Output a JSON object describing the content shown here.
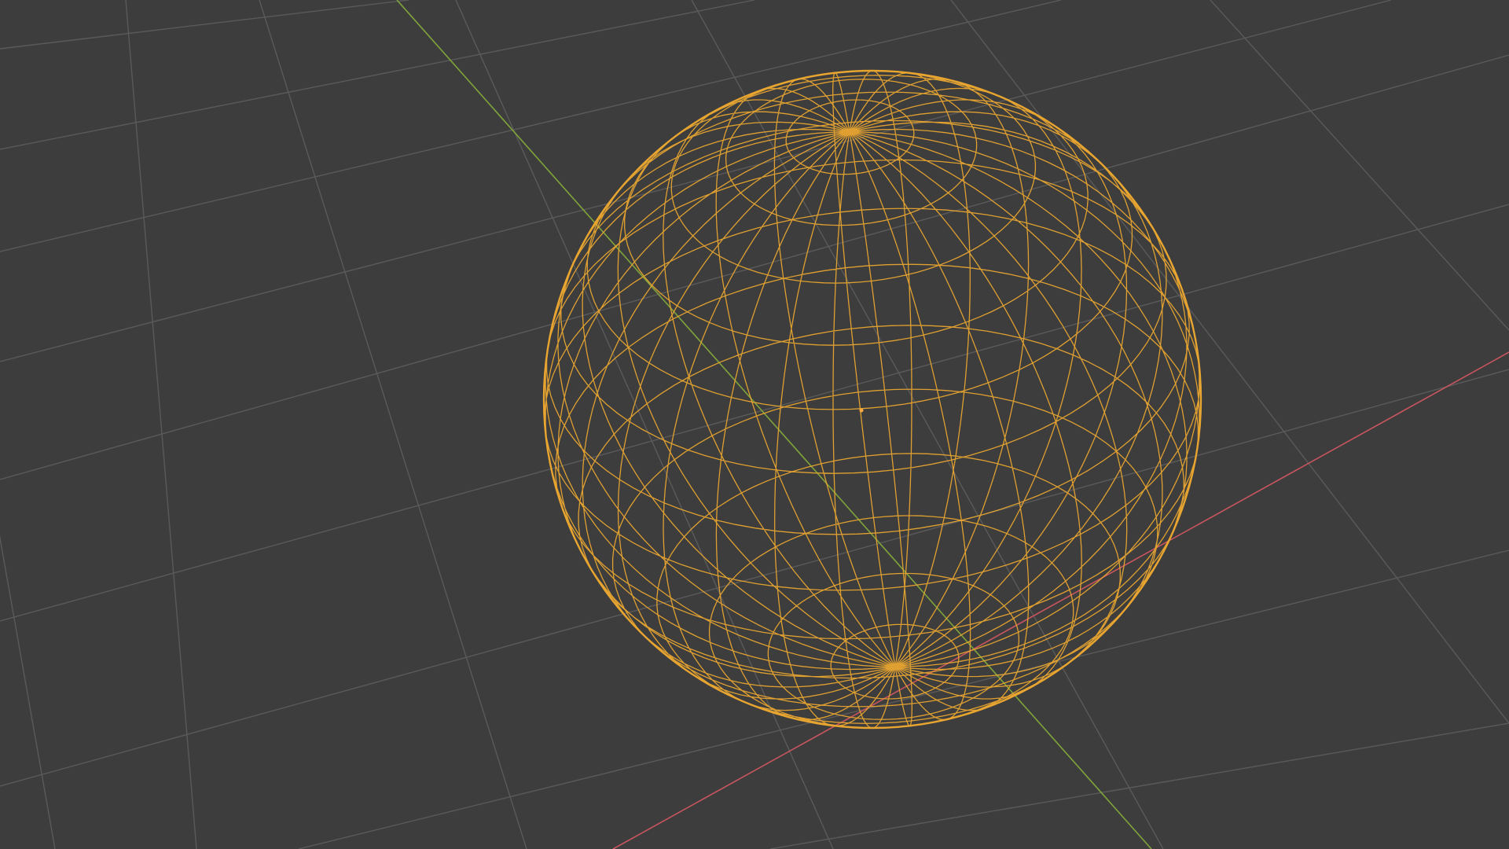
{
  "viewport": {
    "shading": "wireframe",
    "background_color": "#3d3d3d",
    "grid_color": "#5a5a5a",
    "x_axis_color": "#c9555f",
    "y_axis_color": "#7fa33b",
    "selection_color": "#e8a530",
    "origin_color": "#ffaa40"
  },
  "object": {
    "type": "uv-sphere",
    "selected": true,
    "segments": 32,
    "rings": 16
  }
}
